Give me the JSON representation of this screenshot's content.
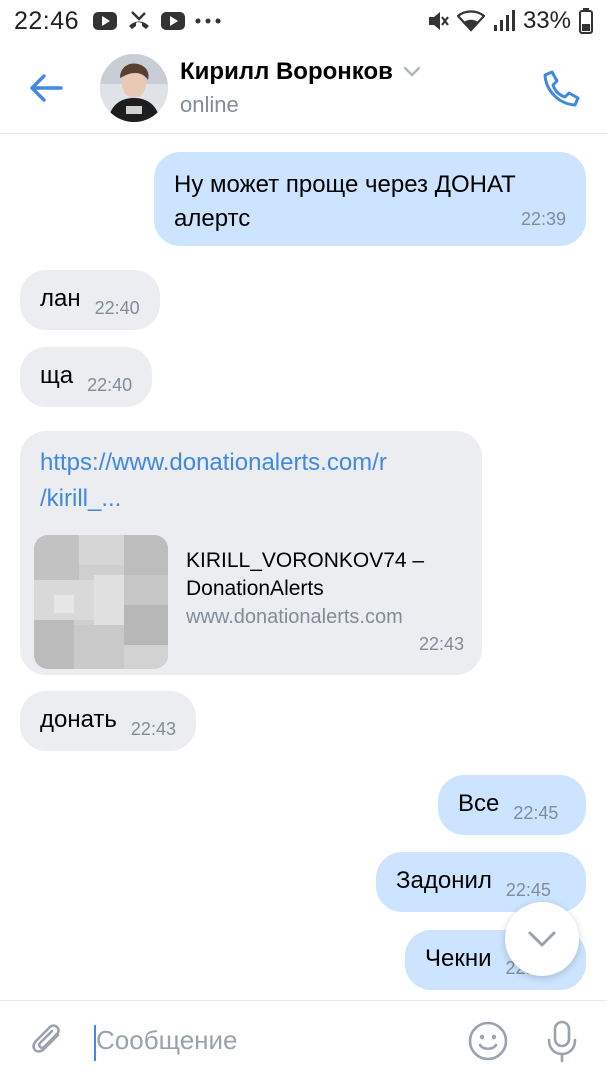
{
  "status_bar": {
    "time": "22:46",
    "battery": "33%",
    "icons_left": [
      "youtube-icon",
      "missed-call-icon",
      "youtube-icon",
      "more-dots-icon"
    ],
    "icons_right": [
      "mute-icon",
      "wifi-icon",
      "signal-icon"
    ]
  },
  "header": {
    "name": "Кирилл Воронков",
    "status": "online"
  },
  "messages": [
    {
      "direction": "out",
      "text_line1": "Ну может проще через ДОНАТ",
      "text_line2": "алертс",
      "time": "22:39"
    },
    {
      "direction": "in",
      "text": "лан",
      "time": "22:40"
    },
    {
      "direction": "in",
      "text": "ща",
      "time": "22:40"
    },
    {
      "direction": "in",
      "link_line1": "https://www.donationalerts.com/r",
      "link_line2": "/kirill_...",
      "preview_title_line1": "KIRILL_VORONKOV74 –",
      "preview_title_line2": "DonationAlerts",
      "preview_url": "www.donationalerts.com",
      "time": "22:43"
    },
    {
      "direction": "in",
      "text": "донать",
      "time": "22:43"
    },
    {
      "direction": "out",
      "text": "Все",
      "time": "22:45"
    },
    {
      "direction": "out",
      "text": "Задонил",
      "time": "22:45"
    },
    {
      "direction": "out",
      "text": "Чекни",
      "time": "22:46"
    }
  ],
  "composer": {
    "placeholder": "Сообщение"
  },
  "colors": {
    "accent": "#3f8ae0",
    "outgoing_bubble": "#cce4ff",
    "incoming_bubble": "#ebedf0",
    "secondary_text": "#818c99"
  }
}
